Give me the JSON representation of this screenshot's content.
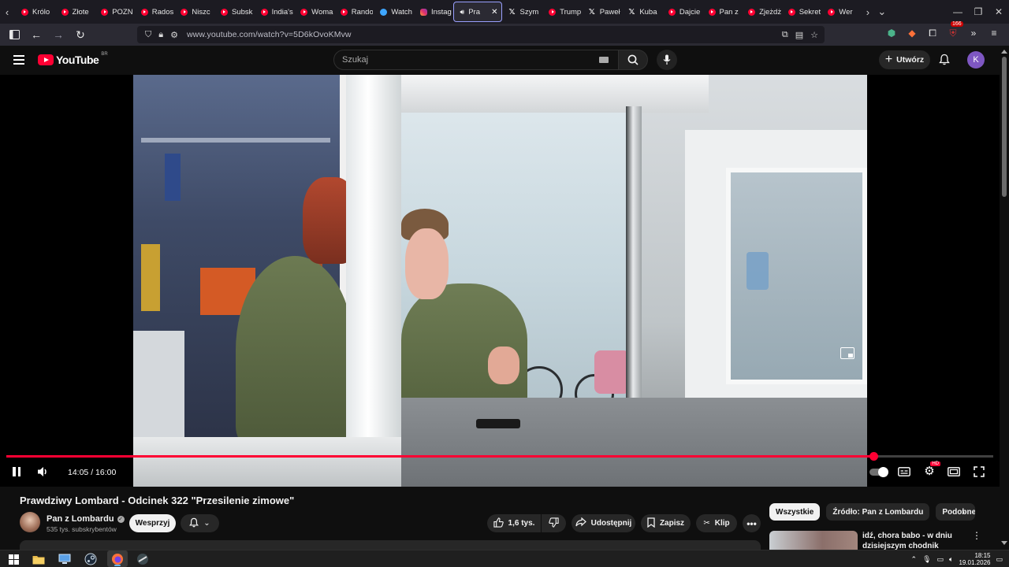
{
  "browser": {
    "tabs": [
      {
        "label": "Królo",
        "favicon": "youtube-icon"
      },
      {
        "label": "Złote",
        "favicon": "youtube-icon"
      },
      {
        "label": "POZN",
        "favicon": "youtube-icon"
      },
      {
        "label": "Rados",
        "favicon": "youtube-icon"
      },
      {
        "label": "Niszc",
        "favicon": "youtube-icon"
      },
      {
        "label": "Subsk",
        "favicon": "youtube-icon"
      },
      {
        "label": "India's",
        "favicon": "youtube-icon"
      },
      {
        "label": "Woma",
        "favicon": "youtube-icon"
      },
      {
        "label": "Rando",
        "favicon": "youtube-icon"
      },
      {
        "label": "Watch",
        "favicon": "watch-icon"
      },
      {
        "label": "Instag",
        "favicon": "instagram-icon"
      },
      {
        "label": "Pra",
        "favicon": "speaker-icon",
        "active": true
      },
      {
        "label": "Szym",
        "favicon": "x-icon"
      },
      {
        "label": "Trump",
        "favicon": "youtube-icon"
      },
      {
        "label": "Paweł",
        "favicon": "x-icon"
      },
      {
        "label": "Kuba",
        "favicon": "x-icon"
      },
      {
        "label": "Dajcie",
        "favicon": "youtube-icon"
      },
      {
        "label": "Pan z",
        "favicon": "youtube-icon"
      },
      {
        "label": "Zjeżdż",
        "favicon": "youtube-icon"
      },
      {
        "label": "Sekret",
        "favicon": "youtube-icon"
      },
      {
        "label": "Wer",
        "favicon": "youtube-icon"
      }
    ],
    "url": "www.youtube.com/watch?v=5D6kOvoKMvw",
    "extension_badge": "166"
  },
  "masthead": {
    "logo_text": "YouTube",
    "country_code": "BR",
    "search_placeholder": "Szukaj",
    "create_label": "Utwórz",
    "avatar_letter": "K"
  },
  "player": {
    "current_time": "14:05",
    "duration": "16:00",
    "time_display": "14:05 / 16:00",
    "progress_fraction": 0.879,
    "hd_badge": "HD"
  },
  "video": {
    "title": "Prawdziwy Lombard - Odcinek 322 \"Przesilenie zimowe\"",
    "channel_name": "Pan z Lombardu",
    "subscribers": "535 tys. subskrybentów",
    "support_label": "Wesprzyj",
    "like_count": "1,6 tys.",
    "share_label": "Udostępnij",
    "save_label": "Zapisz",
    "clip_label": "Klip"
  },
  "sidebar": {
    "chips": [
      "Wszystkie",
      "Źródło: Pan z Lombardu",
      "Podobne"
    ],
    "recommended_title": "idź, chora babo - w dniu dzisiejszym chodnik nieszym"
  },
  "taskbar": {
    "time": "18:15",
    "date": "19.01.2026"
  },
  "colors": {
    "accent": "#ff0033",
    "background": "#0f0f0f",
    "surface": "#272727"
  }
}
